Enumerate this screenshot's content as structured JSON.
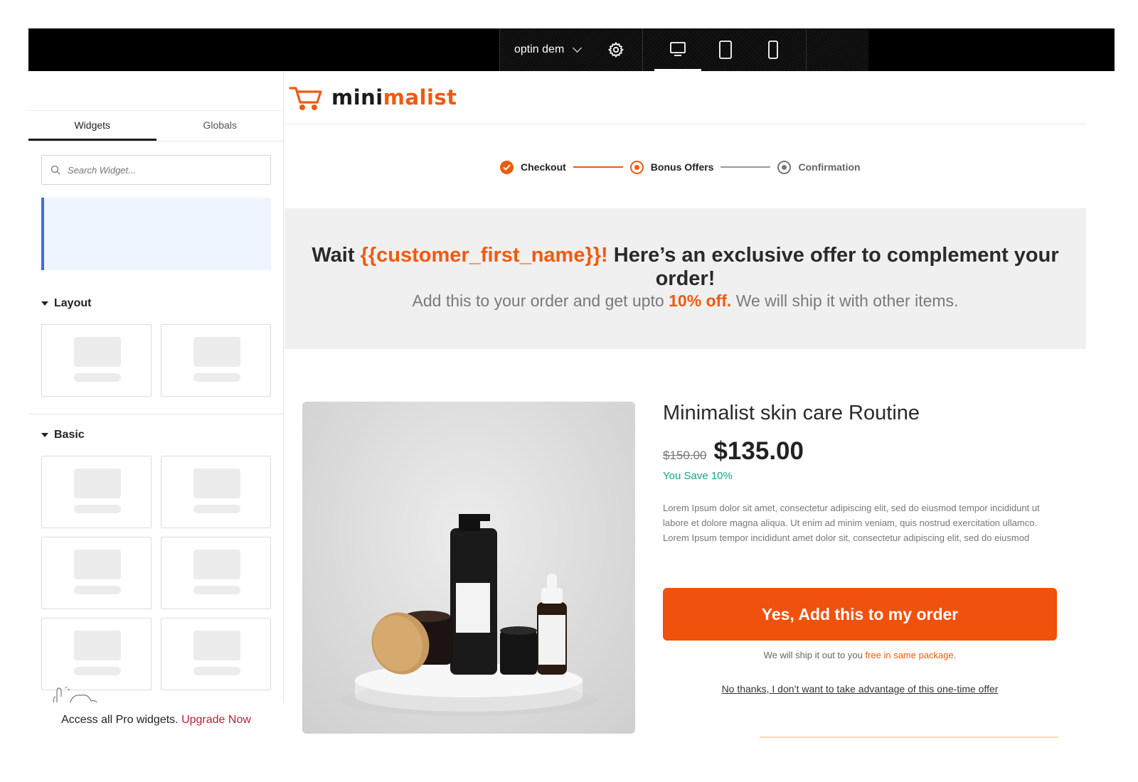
{
  "topbar": {
    "page_name": "optin dem",
    "devices": [
      "desktop",
      "tablet",
      "mobile"
    ],
    "active_device": "desktop",
    "icons": {
      "settings": "gear-icon",
      "dropdown": "chevron-down-icon"
    }
  },
  "sidebar": {
    "tabs": [
      {
        "label": "Widgets",
        "active": true
      },
      {
        "label": "Globals",
        "active": false
      }
    ],
    "search": {
      "placeholder": "Search Widget...",
      "icon": "search-icon"
    },
    "sections": {
      "layout": "Layout",
      "basic": "Basic"
    },
    "upgrade": {
      "text": "Access all Pro widgets.",
      "link": "Upgrade Now"
    }
  },
  "brand": {
    "logo_dark": "mini",
    "logo_orange": "malist",
    "accent": "#ef5a0f",
    "icon": "cart-icon"
  },
  "steps": [
    {
      "label": "Checkout",
      "state": "done"
    },
    {
      "label": "Bonus Offers",
      "state": "current"
    },
    {
      "label": "Confirmation",
      "state": "todo"
    }
  ],
  "offer": {
    "title_prefix": "Wait ",
    "title_token": "{{customer_first_name}}!",
    "title_suffix": " Here’s an exclusive offer to complement your order!",
    "sub_prefix": "Add this to your order and get upto ",
    "sub_highlight": "10% off.",
    "sub_suffix": " We will ship it with other items."
  },
  "product": {
    "name": "Minimalist skin care Routine",
    "old_price": "$150.00",
    "new_price": "$135.00",
    "save": "You Save 10%",
    "description": "Lorem Ipsum dolor sit amet, consectetur adipiscing elit, sed do eiusmod tempor incididunt ut labore et dolore magna aliqua. Ut enim ad minim veniam, quis nostrud exercitation ullamco. Lorem Ipsum tempor incididunt amet dolor sit, consectetur adipiscing elit, sed do eiusmod",
    "cta": "Yes, Add this to my order",
    "ship_prefix": "We will ship it out to you ",
    "ship_highlight": "free in same package",
    "ship_suffix": ".",
    "decline": "No thanks, I don’t want to take advantage of this one-time offer"
  }
}
